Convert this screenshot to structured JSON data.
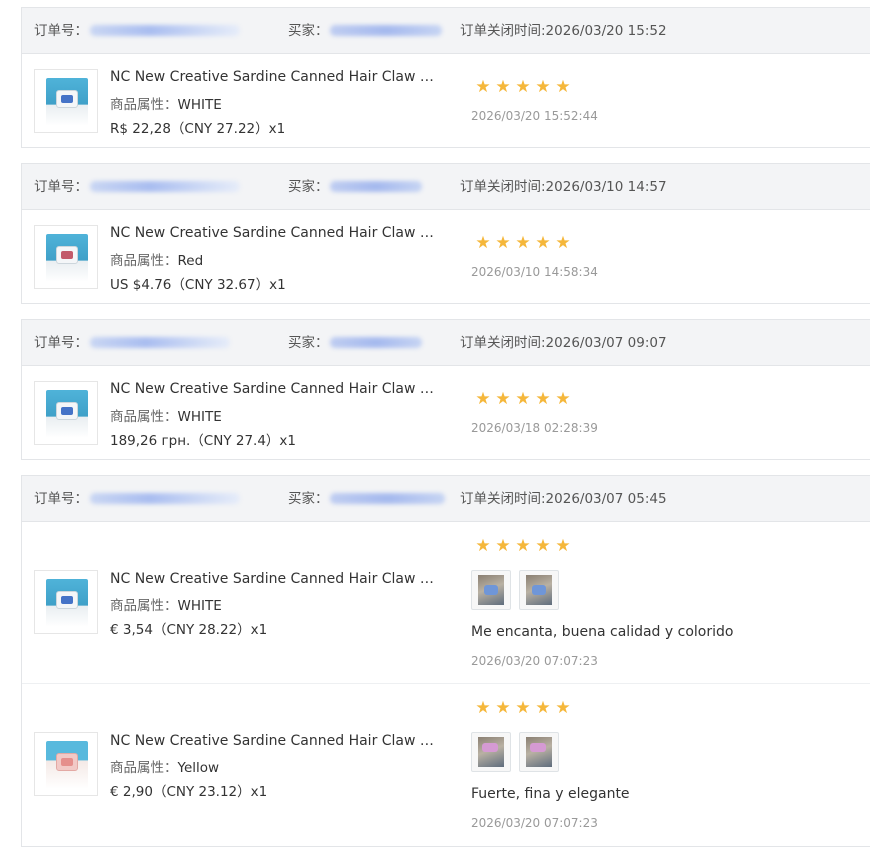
{
  "labels": {
    "order_no": "订单号：",
    "buyer": "买家：",
    "attr_key": "商品属性："
  },
  "orders": [
    {
      "close_time": "订单关闭时间:2026/03/20 15:52",
      "items": [
        {
          "thumb_icon": "product-thumbnail-blue",
          "title": "NC New Creative Sardine Canned Hair Claw Acr...",
          "attr": "WHITE",
          "price": "R$ 22,28（CNY  27.22）x1",
          "rating": 5,
          "review_time": "2026/03/20 15:52:44"
        }
      ]
    },
    {
      "close_time": "订单关闭时间:2026/03/10 14:57",
      "items": [
        {
          "thumb_icon": "product-thumbnail-red",
          "title": "NC New Creative Sardine Canned Hair Claw Acr...",
          "attr": "Red",
          "price": "US $4.76（CNY  32.67）x1",
          "rating": 5,
          "review_time": "2026/03/10 14:58:34"
        }
      ]
    },
    {
      "close_time": "订单关闭时间:2026/03/07 09:07",
      "items": [
        {
          "thumb_icon": "product-thumbnail-blue",
          "title": "NC New Creative Sardine Canned Hair Claw Acr...",
          "attr": "WHITE",
          "price": "189,26 грн.（CNY  27.4）x1",
          "rating": 5,
          "review_time": "2026/03/18 02:28:39"
        }
      ]
    },
    {
      "close_time": "订单关闭时间:2026/03/07 05:45",
      "items": [
        {
          "thumb_icon": "product-thumbnail-blue",
          "title": "NC New Creative Sardine Canned Hair Claw Acr...",
          "attr": "WHITE",
          "price": "€ 3,54（CNY  28.22）x1",
          "rating": 5,
          "review_text": "Me encanta, buena calidad y colorido",
          "review_time": "2026/03/20 07:07:23"
        },
        {
          "thumb_icon": "product-thumbnail-yellow",
          "title": "NC New Creative Sardine Canned Hair Claw Acr...",
          "attr": "Yellow",
          "price": "€ 2,90（CNY  23.12）x1",
          "rating": 5,
          "review_text": "Fuerte, fina y elegante",
          "review_time": "2026/03/20 07:07:23"
        }
      ]
    }
  ],
  "colors": {
    "star": "#f5b73b",
    "header_bg": "#f3f4f6",
    "border": "#e3e5e8"
  }
}
